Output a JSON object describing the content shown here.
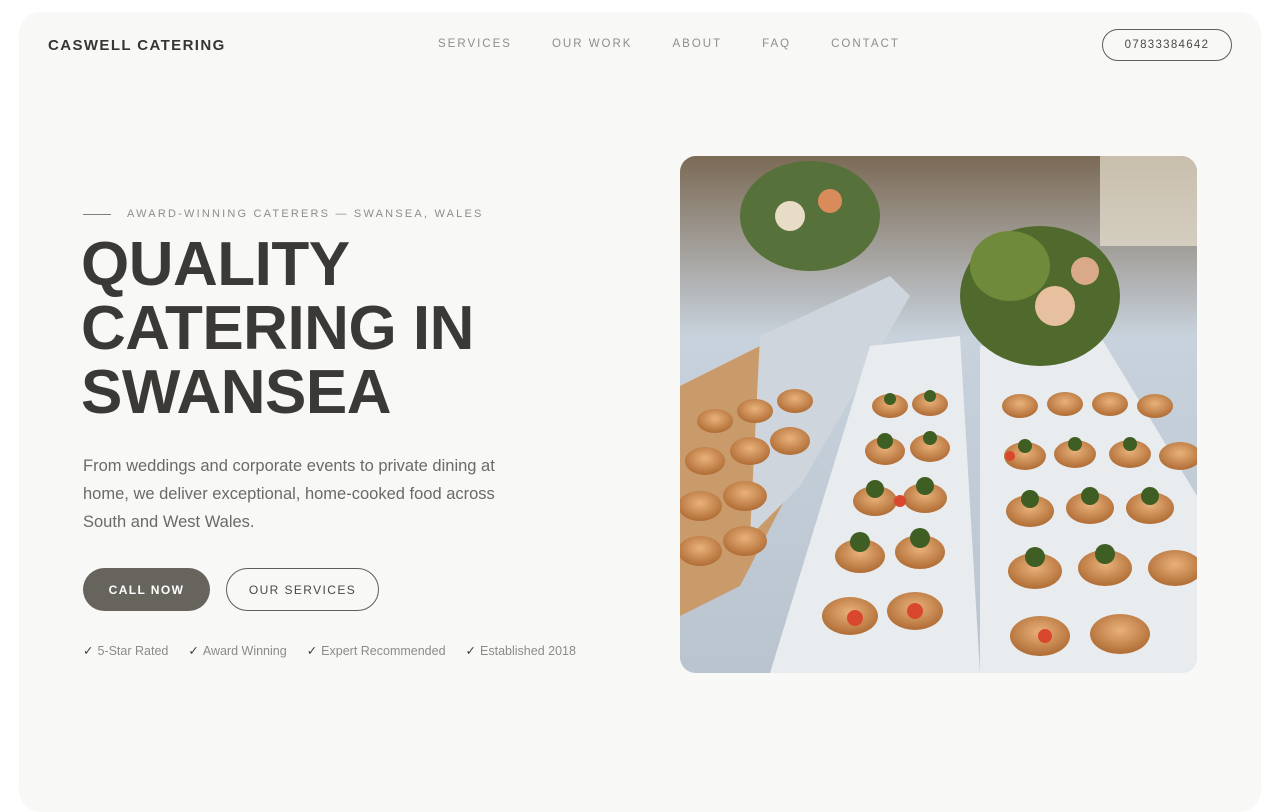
{
  "header": {
    "brand": "CASWELL CATERING",
    "nav": [
      {
        "label": "SERVICES"
      },
      {
        "label": "OUR WORK"
      },
      {
        "label": "ABOUT"
      },
      {
        "label": "FAQ"
      },
      {
        "label": "CONTACT"
      }
    ],
    "phone": "07833384642"
  },
  "hero": {
    "eyebrow": "AWARD-WINNING CATERERS — SWANSEA, WALES",
    "headline_lines": [
      "QUALITY",
      "CATERING IN",
      "SWANSEA"
    ],
    "description": "From weddings and corporate events to private dining at home, we deliver exceptional, home-cooked food across South and West Wales.",
    "primary_button": "CALL NOW",
    "secondary_button": "OUR SERVICES",
    "badges": [
      {
        "check": "✓",
        "label": "5-Star Rated"
      },
      {
        "check": "✓",
        "label": "Award Winning"
      },
      {
        "check": "✓",
        "label": "Expert Recommended"
      },
      {
        "check": "✓",
        "label": "Established 2018"
      }
    ],
    "image_icon": "catering-canape-platter-photo"
  },
  "colors": {
    "page_bg": "#f8f8f6",
    "text_dark": "#3a3936",
    "text_muted": "#8d8d89",
    "button_primary": "#67645e"
  }
}
